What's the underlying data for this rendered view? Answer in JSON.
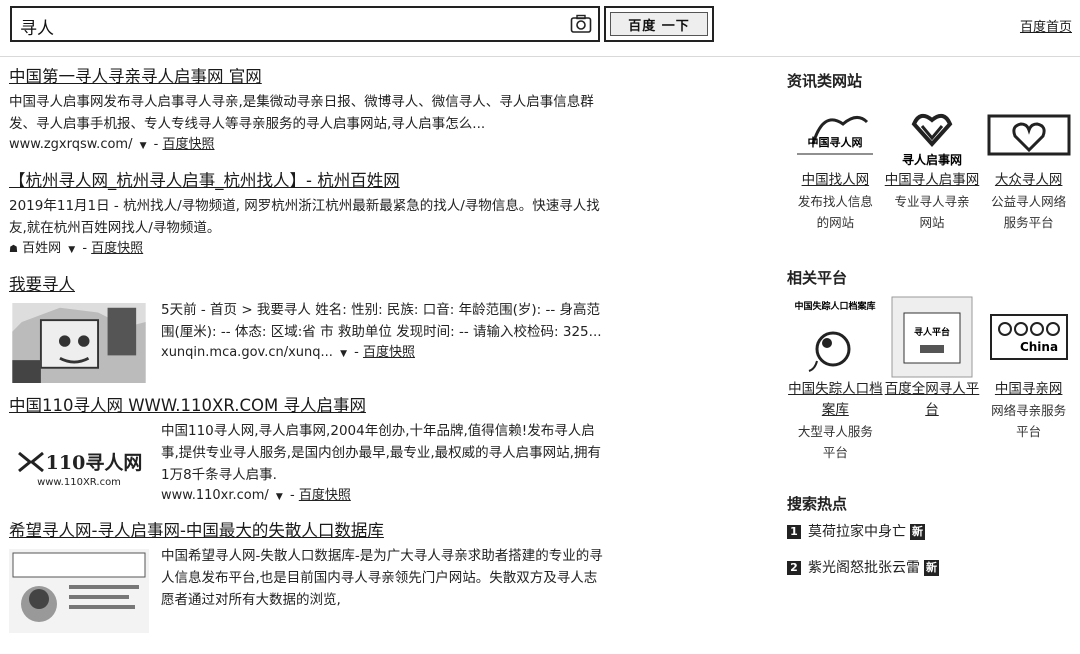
{
  "search": {
    "query": "寻人",
    "button_label": "百度 一下",
    "home_link": "百度首页"
  },
  "results": [
    {
      "title": "中国第一寻人寻亲寻人启事网 官网",
      "abstract": "中国寻人启事网发布寻人启事寻人寻亲,是集微动寻亲日报、微博寻人、微信寻人、寻人启事信息群发、寻人启事手机报、专人专线寻人等寻亲服务的寻人启事网站,寻人启事怎么...",
      "url": "www.zgxrqsw.com/",
      "snapshot": "百度快照"
    },
    {
      "title": "【杭州寻人网_杭州寻人启事_杭州找人】- 杭州百姓网",
      "abstract": "2019年11月1日 - 杭州找人/寻物频道, 网罗杭州浙江杭州最新最紧急的找人/寻物信息。快速寻人找友,就在杭州百姓网找人/寻物频道。",
      "url": "百姓网",
      "snapshot": "百度快照"
    },
    {
      "title": "我要寻人",
      "abstract": "5天前 - 首页 > 我要寻人 姓名: 性别: 民族: 口音: 年龄范围(岁): -- 身高范围(厘米): -- 体态: 区域:省 市 救助单位 发现时间: -- 请输入校检码: 325...",
      "url": "xunqin.mca.gov.cn/xunq...",
      "snapshot": "百度快照"
    },
    {
      "title": "中国110寻人网 WWW.110XR.COM 寻人启事网",
      "abstract": "中国110寻人网,寻人启事网,2004年创办,十年品牌,值得信赖!发布寻人启事,提供专业寻人服务,是国内创办最早,最专业,最权威的寻人启事网站,拥有1万8千条寻人启事.",
      "url": "www.110xr.com/",
      "snapshot": "百度快照",
      "logo_text": "110寻人网",
      "logo_sub": "www.110XR.com"
    },
    {
      "title": "希望寻人网-寻人启事网-中国最大的失散人口数据库",
      "abstract": "中国希望寻人网-失散人口数据库-是为广大寻人寻亲求助者搭建的专业的寻人信息发布平台,也是目前国内寻人寻亲领先门户网站。失散双方及寻人志愿者通过对所有大数据的浏览,"
    }
  ],
  "sidebar": {
    "news_heading": "资讯类网站",
    "news_sites": [
      {
        "name": "中国找人网",
        "desc": "发布找人信息的网站",
        "logo_text": "中国寻人网"
      },
      {
        "name": "中国寻人启事网",
        "desc": "专业寻人寻亲网站",
        "logo_text": "寻人启事网"
      },
      {
        "name": "大众寻人网",
        "desc": "公益寻人网络服务平台",
        "logo_text": ""
      }
    ],
    "platform_heading": "相关平台",
    "platforms": [
      {
        "name": "中国失踪人口档案库",
        "desc": "大型寻人服务平台",
        "logo_text": "中国失踪人口档案库"
      },
      {
        "name": "百度全网寻人平台",
        "desc": "",
        "logo_text": "寻人平台"
      },
      {
        "name": "中国寻亲网",
        "desc": "网络寻亲服务平台",
        "logo_text": "China"
      }
    ],
    "hot_heading": "搜索热点",
    "hot": [
      {
        "num": "1",
        "text": "莫荷拉家中身亡",
        "badge": "新"
      },
      {
        "num": "2",
        "text": "紫光阁怒批张云雷",
        "badge": "新"
      }
    ]
  },
  "colors": {
    "text": "#222222",
    "border": "#222222",
    "divider": "#d9d9d9"
  }
}
